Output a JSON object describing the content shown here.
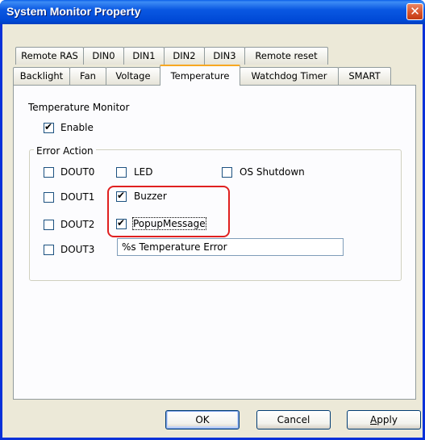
{
  "window": {
    "title": "System Monitor Property",
    "close_glyph": "✕"
  },
  "tabs": {
    "row1": [
      "Remote RAS",
      "DIN0",
      "DIN1",
      "DIN2",
      "DIN3",
      "Remote reset"
    ],
    "row2": [
      "Backlight",
      "Fan",
      "Voltage",
      "Temperature",
      "Watchdog Timer",
      "SMART"
    ],
    "active": "Temperature"
  },
  "temperature_monitor": {
    "heading": "Temperature Monitor",
    "enable_label": "Enable",
    "enable_checked": true
  },
  "error_action": {
    "caption": "Error Action",
    "dout0_label": "DOUT0",
    "dout1_label": "DOUT1",
    "dout2_label": "DOUT2",
    "dout3_label": "DOUT3",
    "led_label": "LED",
    "os_shutdown_label": "OS Shutdown",
    "buzzer_label": "Buzzer",
    "popup_label": "PopupMessage",
    "message_value": "%s Temperature Error"
  },
  "buttons": {
    "ok": "OK",
    "cancel": "Cancel",
    "apply": "Apply"
  },
  "colors": {
    "title_bar": "#0a58e2",
    "active_tab_accent": "#f7a822",
    "highlight": "#e02020"
  }
}
